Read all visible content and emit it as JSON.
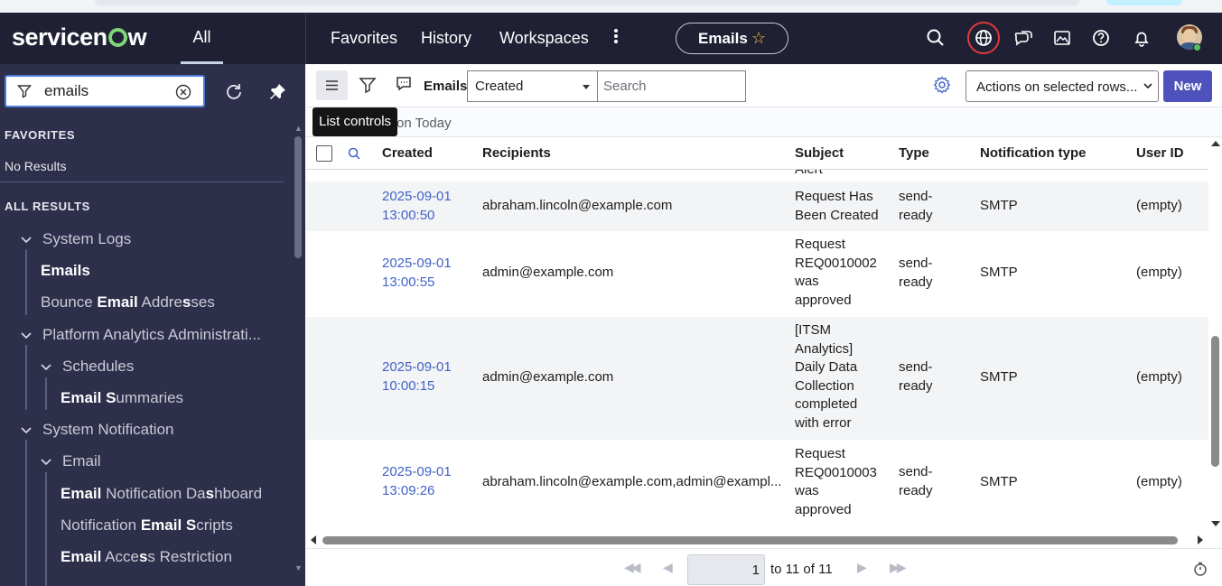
{
  "header": {
    "logo_text_pre": "servicen",
    "logo_text_post": "w",
    "all_tab": "All",
    "nav": [
      "Favorites",
      "History",
      "Workspaces"
    ],
    "context_title": "Emails",
    "icons": [
      "search-icon",
      "globe-icon",
      "chat-icon",
      "image-icon",
      "help-icon",
      "bell-icon"
    ]
  },
  "sidebar": {
    "filter_value": "emails",
    "favorites_heading": "FAVORITES",
    "favorites_empty": "No Results",
    "all_results_heading": "ALL RESULTS",
    "tree": [
      {
        "level": 0,
        "expanded": true,
        "text": "System Logs"
      },
      {
        "level": 1,
        "active": true,
        "text": "Emails"
      },
      {
        "level": 1,
        "parts": [
          "Bounce ",
          "Email",
          " Addre",
          "s",
          "ses"
        ]
      },
      {
        "level": 0,
        "expanded": true,
        "text": "Platform Analytics Administrati..."
      },
      {
        "level": 1,
        "expanded": true,
        "text": "Schedules"
      },
      {
        "level": 2,
        "parts": [
          "Email",
          " S",
          "ummaries"
        ]
      },
      {
        "level": 0,
        "expanded": true,
        "text": "System Notification"
      },
      {
        "level": 1,
        "expanded": true,
        "text": "Email"
      },
      {
        "level": 2,
        "parts": [
          "Email",
          " Notification Da",
          "s",
          "hboard"
        ]
      },
      {
        "level": 2,
        "parts": [
          "Notification ",
          "Email",
          " ",
          "S",
          "cripts"
        ]
      },
      {
        "level": 2,
        "parts": [
          "Email",
          " Acce",
          "s",
          "s Restriction"
        ]
      }
    ]
  },
  "toolbar": {
    "list_label": "Emails",
    "field_select": "Created",
    "search_placeholder": "Search",
    "actions_select": "Actions on selected rows...",
    "new_button": "New",
    "tooltip": "List controls"
  },
  "breadcrumb": {
    "text": "on Today"
  },
  "table": {
    "columns": [
      "Created",
      "Recipients",
      "Subject",
      "Type",
      "Notification type",
      "User ID"
    ],
    "clipped_text": "Alert",
    "rows": [
      {
        "created": [
          "2025-09-01",
          "13:00:50"
        ],
        "recipients": "abraham.lincoln@example.com",
        "subject": [
          "Request Has",
          "Been Created"
        ],
        "type": [
          "send-",
          "ready"
        ],
        "notification_type": "SMTP",
        "user_id": "(empty)"
      },
      {
        "created": [
          "2025-09-01",
          "13:00:55"
        ],
        "recipients": "admin@example.com",
        "subject": [
          "Request",
          "REQ0010002",
          "was",
          "approved"
        ],
        "type": [
          "send-",
          "ready"
        ],
        "notification_type": "SMTP",
        "user_id": "(empty)"
      },
      {
        "created": [
          "2025-09-01",
          "10:00:15"
        ],
        "recipients": "admin@example.com",
        "subject": [
          "[ITSM",
          "Analytics]",
          "Daily Data",
          "Collection",
          "completed",
          "with error"
        ],
        "type": [
          "send-",
          "ready"
        ],
        "notification_type": "SMTP",
        "user_id": "(empty)"
      },
      {
        "created": [
          "2025-09-01",
          "13:09:26"
        ],
        "recipients": "abraham.lincoln@example.com,admin@exampl...",
        "subject": [
          "Request",
          "REQ0010003",
          "was",
          "approved"
        ],
        "type": [
          "send-",
          "ready"
        ],
        "notification_type": "SMTP",
        "user_id": "(empty)"
      }
    ]
  },
  "pagination": {
    "page_value": "1",
    "range_text": "to 11 of 11"
  },
  "colors": {
    "nav_bg": "#1f2033",
    "sidebar_bg": "#2e2f4a",
    "primary_button": "#4f52bd",
    "link": "#4262c7",
    "logo_accent": "#80d47a"
  }
}
